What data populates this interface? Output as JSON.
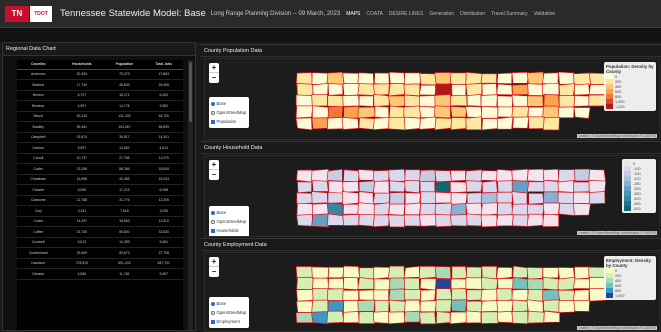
{
  "header": {
    "logo_text": "TN",
    "logo_sub": [
      "TDOT"
    ],
    "title": "Tennessee Statewide Model: Base",
    "subtitle": "Long Range Planning Division -- 09 March, 2023",
    "nav": [
      "MAPS",
      "COATA",
      "DESIRE LINES",
      "Generation",
      "Distribution",
      "Travel Summary",
      "Validation"
    ]
  },
  "left_panel": {
    "title": "Regional Data Chart",
    "columns": [
      "Counties",
      "Households",
      "Population",
      "Total Jobs"
    ],
    "rows": [
      [
        "Anderson",
        "30,253",
        "75,379",
        "47,863"
      ],
      [
        "Bedford",
        "17,744",
        "48,609",
        "25,459"
      ],
      [
        "Benton",
        "6,707",
        "16,271",
        "6,402"
      ],
      [
        "Bledsoe",
        "4,997",
        "14,778",
        "3,982"
      ],
      [
        "Blount",
        "53,310",
        "131,349",
        "64,700"
      ],
      [
        "Bradley",
        "39,461",
        "104,267",
        "55,839"
      ],
      [
        "Campbell",
        "15,874",
        "39,517",
        "14,301"
      ],
      [
        "Cannon",
        "5,597",
        "14,062",
        "4,614"
      ],
      [
        "Carroll",
        "10,737",
        "27,768",
        "11,070"
      ],
      [
        "Carter",
        "23,256",
        "56,356",
        "18,545"
      ],
      [
        "Cheatham",
        "15,598",
        "40,465",
        "15,234"
      ],
      [
        "Chester",
        "6,095",
        "17,215",
        "6,098"
      ],
      [
        "Claiborne",
        "12,788",
        "31,776",
        "13,306"
      ],
      [
        "Clay",
        "3,151",
        "7,615",
        "3,035"
      ],
      [
        "Cocke",
        "14,297",
        "35,863",
        "11,810"
      ],
      [
        "Coffee",
        "21,735",
        "56,520",
        "32,630"
      ],
      [
        "Crockett",
        "5,613",
        "14,399",
        "5,651"
      ],
      [
        "Cumberland",
        "25,469",
        "59,673",
        "27,708"
      ],
      [
        "Davidson",
        "278,619",
        "691,243",
        "647,701"
      ],
      [
        "Decatur",
        "4,966",
        "11,765",
        "5,697"
      ]
    ]
  },
  "maps": [
    {
      "title": "County Population Data",
      "layers": [
        "Base",
        "OpenStreetMap",
        "Population"
      ],
      "legend_title": "Population: Density by County",
      "legend": [
        "0",
        "200",
        "400",
        "600",
        "800",
        "1,000",
        "1,200"
      ],
      "legend_colors": [
        "#fffbd6",
        "#fde7a1",
        "#fdc874",
        "#fca24f",
        "#f0773a",
        "#d8462b",
        "#b01919"
      ],
      "attribution": "Leaflet | © OpenStreetMap contributors © CARTO"
    },
    {
      "title": "County Household Data",
      "layers": [
        "Base",
        "OpenStreetMap",
        "Households"
      ],
      "legend_title": "",
      "legend": [
        "0",
        "-100",
        "-150",
        "-200",
        "-250",
        "-300",
        "-350",
        "-400",
        "-450",
        "-500"
      ],
      "legend_colors": [
        "#f3e4f0",
        "#dcd8ec",
        "#c5cde4",
        "#a8bfdc",
        "#87b0d2",
        "#65a0c4",
        "#4b93b3",
        "#37879e",
        "#23778a",
        "#0f6674"
      ],
      "attribution": "Leaflet | © OpenStreetMap contributors © CARTO"
    },
    {
      "title": "County Employment Data",
      "layers": [
        "Base",
        "OpenStreetMap",
        "Employment"
      ],
      "legend_title": "Employment: Density by County",
      "legend": [
        "0",
        "200",
        "400",
        "600",
        "800",
        "1,000"
      ],
      "legend_colors": [
        "#f7fcc4",
        "#d5eeb3",
        "#a8dbb4",
        "#71c2bd",
        "#3c98c2",
        "#23459c"
      ],
      "attribution": "Leaflet | © OpenStreetMap contributors © CARTO"
    }
  ]
}
